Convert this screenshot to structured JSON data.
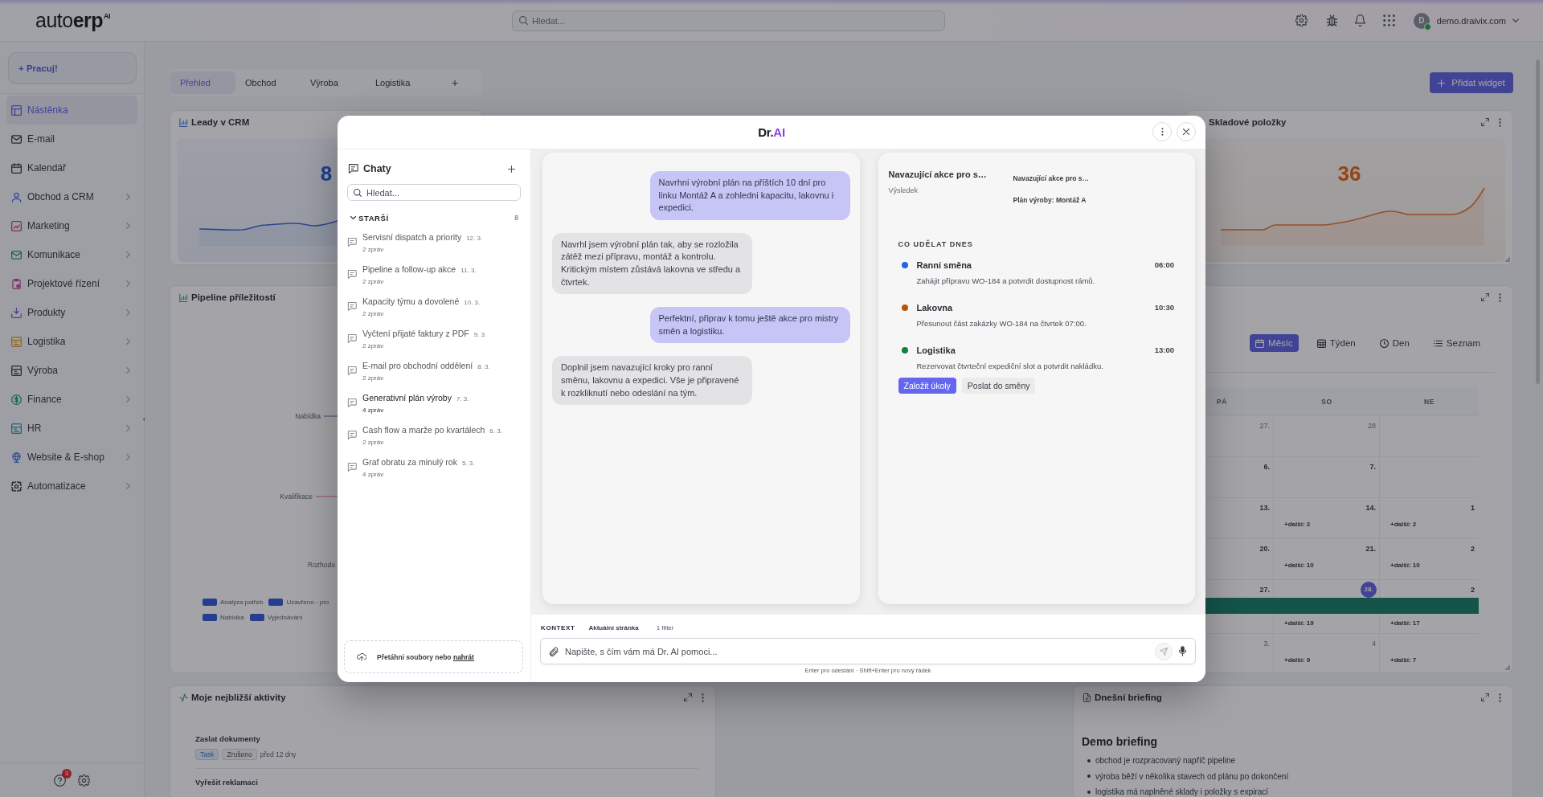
{
  "topbar": {
    "logo": "auto**erp**$^{AI}$",
    "search": {
      "placeholder": "Hledat..."
    },
    "user": {
      "initial": "D",
      "name": "demo.draivix.com",
      "online": true
    }
  },
  "sidebar": {
    "action": "+ Pracuj!",
    "items": [
      {
        "label": "Nástěnka",
        "selected": true,
        "expandable": false
      },
      {
        "label": "E-mail",
        "selected": false,
        "expandable": false
      },
      {
        "label": "Kalendář",
        "selected": false,
        "expandable": false
      },
      {
        "label": "Obchod a CRM",
        "selected": false,
        "expandable": true
      },
      {
        "label": "Marketing",
        "selected": false,
        "expandable": true
      },
      {
        "label": "Komunikace",
        "selected": false,
        "expandable": true
      },
      {
        "label": "Projektové řízení",
        "selected": false,
        "expandable": true
      },
      {
        "label": "Produkty",
        "selected": false,
        "expandable": true
      },
      {
        "label": "Logistika",
        "selected": false,
        "expandable": true
      },
      {
        "label": "Výroba",
        "selected": false,
        "expandable": true
      },
      {
        "label": "Finance",
        "selected": false,
        "expandable": true
      },
      {
        "label": "HR",
        "selected": false,
        "expandable": true
      },
      {
        "label": "Website & E-shop",
        "selected": false,
        "expandable": true
      },
      {
        "label": "Automatizace",
        "selected": false,
        "expandable": true
      }
    ],
    "help_badge": "3"
  },
  "tabs": [
    {
      "label": "Přehled",
      "selected": true
    },
    {
      "label": "Obchod",
      "selected": false
    },
    {
      "label": "Výroba",
      "selected": false
    },
    {
      "label": "Logistika",
      "selected": false
    }
  ],
  "add_tab": "+",
  "add_widget": "Přidat widget",
  "widgets": {
    "leads": {
      "title": "Leady v CRM",
      "value": "8"
    },
    "stock": {
      "title": "Skladové položky",
      "value": "36"
    },
    "pipeline": {
      "title": "Pipeline příležitostí",
      "labels": [
        "Nabídka",
        "Kvalifikace",
        "Rozhodo"
      ],
      "legend": [
        "Analýza potřeb",
        "Uzavřeno - pro",
        "Nabídka",
        "Vyjednávání"
      ]
    },
    "calendar": {
      "views": [
        {
          "label": "Měsíc",
          "selected": true
        },
        {
          "label": "Týden",
          "selected": false
        },
        {
          "label": "Den",
          "selected": false
        },
        {
          "label": "Seznam",
          "selected": false
        }
      ],
      "weekdays": [
        "PÁ",
        "SO",
        "NE"
      ],
      "weeks": [
        {
          "event_bar": false,
          "days": [
            {
              "date": "27.",
              "muted": true,
              "today": false
            },
            {
              "date": "28",
              "muted": true,
              "today": false
            }
          ]
        },
        {
          "event_bar": false,
          "days": [
            {
              "date": "6.",
              "muted": false,
              "today": false
            },
            {
              "date": "7.",
              "muted": false,
              "today": false
            }
          ]
        },
        {
          "event_bar": false,
          "days": [
            {
              "date": "13.",
              "muted": false,
              "today": false
            },
            {
              "date": "14.",
              "muted": false,
              "today": false,
              "more": "+další: 2"
            },
            {
              "date": "1",
              "muted": false,
              "today": false,
              "more": "+další: 2"
            }
          ]
        },
        {
          "event_bar": false,
          "days": [
            {
              "date": "20.",
              "muted": false,
              "today": false
            },
            {
              "date": "21.",
              "muted": false,
              "today": false,
              "more": "+další: 10"
            },
            {
              "date": "2",
              "muted": false,
              "today": false,
              "more": "+další: 10"
            }
          ]
        },
        {
          "event_bar": true,
          "days": [
            {
              "date": "27.",
              "muted": false,
              "today": false
            },
            {
              "date": "28.",
              "muted": false,
              "today": true,
              "more": "+další: 19"
            },
            {
              "date": "2",
              "muted": false,
              "today": false,
              "more": "+další: 17"
            }
          ]
        },
        {
          "event_bar": false,
          "days": [
            {
              "date": "3.",
              "muted": true,
              "today": false
            },
            {
              "date": "4",
              "muted": true,
              "today": false,
              "more": "+další: 9"
            },
            {
              "more": "+další: 7"
            }
          ]
        }
      ]
    },
    "activities": {
      "title": "Moje nejbližší aktivity",
      "items": [
        {
          "title": "Zaslat dokumenty",
          "type": "Task",
          "status": "Zrušeno",
          "time": "před 12 dny"
        },
        {
          "title": "Vyřešit reklamaci"
        }
      ]
    },
    "briefing": {
      "title": "Dnešní briefing",
      "heading": "Demo briefing",
      "bullets": [
        "obchod je rozpracovaný napříč pipeline",
        "výroba běží v několika stavech od plánu po dokončení",
        "logistika má naplněné sklady i položky s expirací"
      ]
    }
  },
  "assistant": {
    "brand": "Dr.",
    "brand_accent": "AI",
    "chats_title": "Chaty",
    "search": {
      "placeholder": "Hledat..."
    },
    "group": {
      "label": "STARŠÍ",
      "count": "8",
      "expanded": true
    },
    "chats": [
      {
        "title": "Servisní dispatch a priority",
        "date": "12. 3.",
        "meta": "2 zpráv",
        "selected": false
      },
      {
        "title": "Pipeline a follow-up akce",
        "date": "11. 3.",
        "meta": "2 zpráv",
        "selected": false
      },
      {
        "title": "Kapacity týmu a dovolené",
        "date": "10. 3.",
        "meta": "2 zpráv",
        "selected": false
      },
      {
        "title": "Vyčtení přijaté faktury z PDF",
        "date": "9. 3.",
        "meta": "2 zpráv",
        "selected": false
      },
      {
        "title": "E-mail pro obchodní oddělení",
        "date": "8. 3.",
        "meta": "2 zpráv",
        "selected": false
      },
      {
        "title": "Generativní plán výroby",
        "date": "7. 3.",
        "meta": "4 zpráv",
        "selected": true
      },
      {
        "title": "Cash flow a marže po kvartálech",
        "date": "6. 3.",
        "meta": "2 zpráv",
        "selected": false
      },
      {
        "title": "Graf obratu za minulý rok",
        "date": "5. 3.",
        "meta": "4 zpráv",
        "selected": false
      }
    ],
    "upload": {
      "text": "Přetáhni soubory nebo",
      "link": "nahrát"
    },
    "messages": [
      {
        "kind": "user",
        "text": "Navrhni výrobní plán na příštích 10 dní pro linku Montáž A a zohledni kapacitu, lakovnu i expedici."
      },
      {
        "kind": "assistant",
        "text": "Navrhl jsem výrobní plán tak, aby se rozložila zátěž mezi přípravu, montáž a kontrolu. Kritickým místem zůstává lakovna ve středu a čtvrtek."
      },
      {
        "kind": "user",
        "text": "Perfektní, připrav k tomu ještě akce pro mistry směn a logistiku."
      },
      {
        "kind": "assistant",
        "text": "Doplnil jsem navazující kroky pro ranní směnu, lakovnu a expedici. Vše je připravené k rozkliknutí nebo odeslání na tým."
      }
    ],
    "result": {
      "title": "Navazující akce pro s…",
      "subtitle": "Výsledek",
      "links": [
        "Navazující akce pro s…",
        "Plán výroby: Montáž A"
      ],
      "section": "CO UDĚLAT DNES",
      "tasks": [
        {
          "title": "Ranní směna",
          "time": "06:00",
          "text": "Zahájit přípravu WO-184 a potvrdit dostupnost rámů.",
          "color": "#2563eb"
        },
        {
          "title": "Lakovna",
          "time": "10:30",
          "text": "Přesunout část zakázky WO-184 na čtvrtek 07:00.",
          "color": "#b45309"
        },
        {
          "title": "Logistika",
          "time": "13:00",
          "text": "Rezervovat čtvrteční expediční slot a potvrdit nakládku.",
          "color": "#15803d"
        }
      ],
      "actions": [
        {
          "label": "Založit úkoly",
          "kind": "primary"
        },
        {
          "label": "Poslat do směny",
          "kind": "secondary"
        }
      ]
    },
    "context": {
      "label": "KONTEXT",
      "scope": "Aktuální stránka",
      "filter": "1 filter"
    },
    "composer": {
      "placeholder": "Napište, s čím vám má Dr. AI pomoci...",
      "send_enabled": false
    },
    "hint": "Enter pro odeslání · Shift+Enter pro nový řádek"
  }
}
